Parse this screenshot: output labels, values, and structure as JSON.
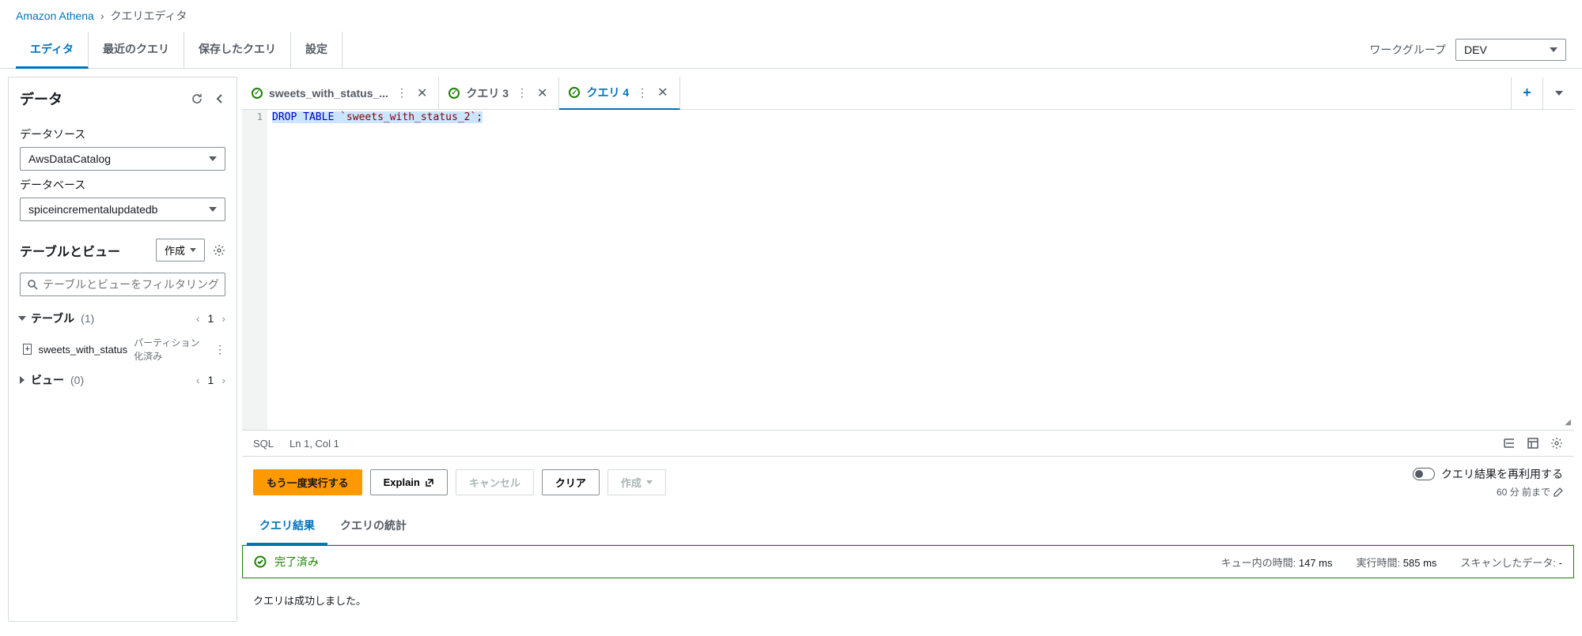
{
  "breadcrumb": {
    "service": "Amazon Athena",
    "page": "クエリエディタ"
  },
  "tabs": {
    "editor": "エディタ",
    "recent": "最近のクエリ",
    "saved": "保存したクエリ",
    "settings": "設定"
  },
  "workgroup": {
    "label": "ワークグループ",
    "value": "DEV"
  },
  "sidebar": {
    "title": "データ",
    "datasource_label": "データソース",
    "datasource_value": "AwsDataCatalog",
    "database_label": "データベース",
    "database_value": "spiceincrementalupdatedb",
    "tables_views_title": "テーブルとビュー",
    "create_btn": "作成",
    "filter_placeholder": "テーブルとビューをフィルタリング",
    "tables_label": "テーブル",
    "tables_count": "(1)",
    "tables_page": "1",
    "table_item_name": "sweets_with_status",
    "table_item_badge": "パーティション化済み",
    "views_label": "ビュー",
    "views_count": "(0)",
    "views_page": "1"
  },
  "editor_tabs": [
    {
      "label": "sweets_with_status_..."
    },
    {
      "label": "クエリ 3"
    },
    {
      "label": "クエリ 4"
    }
  ],
  "code": {
    "line1_num": "1",
    "kw": "DROP TABLE",
    "rest": " `sweets_with_status_2`;"
  },
  "status_bar": {
    "lang": "SQL",
    "pos": "Ln 1, Col 1"
  },
  "actions": {
    "run_again": "もう一度実行する",
    "explain": "Explain",
    "cancel": "キャンセル",
    "clear": "クリア",
    "create": "作成",
    "reuse_label": "クエリ結果を再利用する",
    "reuse_time": "60 分 前まで"
  },
  "results_tabs": {
    "results": "クエリ結果",
    "stats": "クエリの統計"
  },
  "status_banner": {
    "status": "完了済み",
    "queue_label": "キュー内の時間:",
    "queue_value": "147 ms",
    "run_label": "実行時間:",
    "run_value": "585 ms",
    "scan_label": "スキャンしたデータ:",
    "scan_value": "-"
  },
  "result_message": "クエリは成功しました。"
}
